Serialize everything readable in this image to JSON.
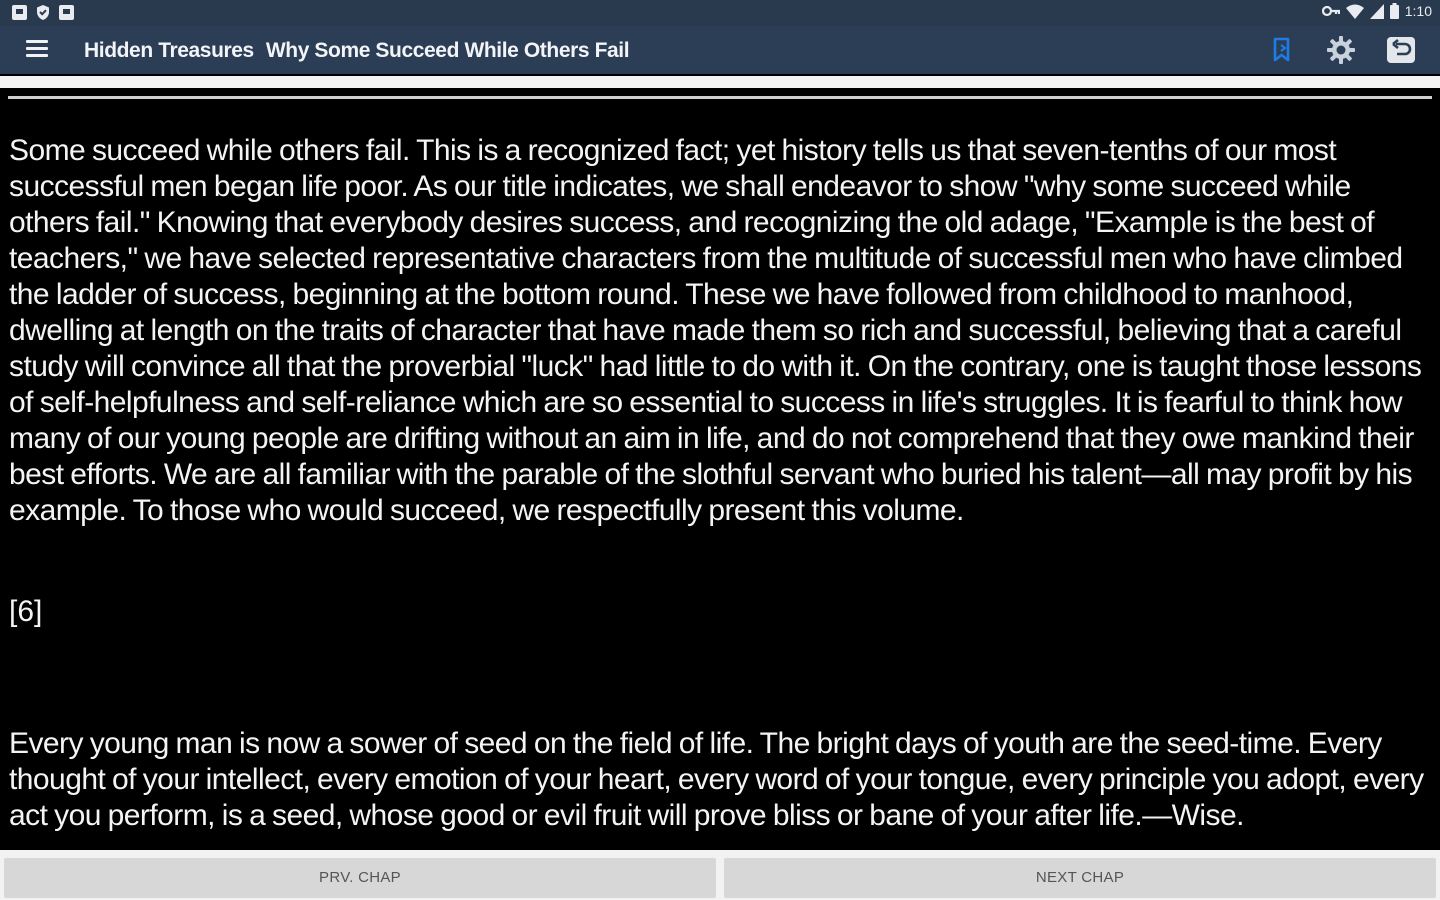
{
  "status_bar": {
    "time": "1:10",
    "icons": [
      "notification-icon",
      "shield-icon",
      "notification-icon",
      "vpn-key-icon",
      "wifi-icon",
      "signal-icon",
      "battery-icon"
    ]
  },
  "app_bar": {
    "title": "Hidden Treasures",
    "subtitle": "Why Some Succeed While Others Fail",
    "icons": [
      "menu-icon",
      "bookmark-icon",
      "gear-icon",
      "back-icon"
    ],
    "bookmark_color": "#1e7be8"
  },
  "content": {
    "paragraph1": "Some succeed while others fail. This is a recognized fact; yet history tells us that seven-tenths of our most successful men began life poor. As our title indicates, we shall endeavor to show \"why some succeed while others fail.\" Knowing that everybody desires success, and recognizing the old adage, \"Example is the best of teachers,\" we have selected representative characters from the multitude of successful men who have climbed the ladder of success, beginning at the bottom round. These we have followed from childhood to manhood, dwelling at length on the traits of character that have made them so rich and successful, believing that a careful study will convince all that the proverbial \"luck\" had little to do with it. On the contrary, one is taught those lessons of self-helpfulness and self-reliance which are so essential to success in life's struggles. It is fearful to think how many of our young people are drifting without an aim in life, and do not comprehend that they owe mankind their best efforts. We are all familiar with the parable of the slothful servant who buried his talent—all may profit by his example. To those who would succeed, we respectfully present this volume.",
    "page_number": "[6]",
    "paragraph2": "Every young man is now a sower of seed on the field of life. The bright days of youth are the seed-time. Every thought of your intellect, every emotion of your heart, every word of your tongue, every principle you adopt, every act you perform, is a seed, whose good or evil fruit will prove bliss or bane of your after life.—Wise."
  },
  "bottom_bar": {
    "prev_label": "PRV. CHAP",
    "next_label": "NEXT CHAP"
  }
}
